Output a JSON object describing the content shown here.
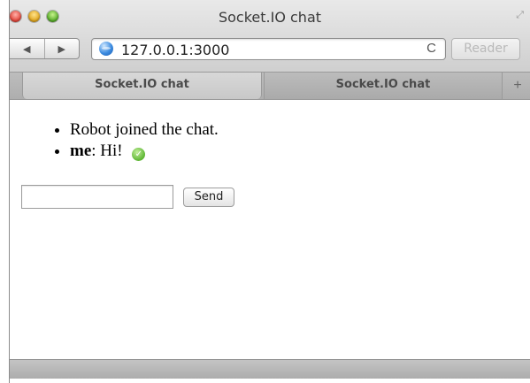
{
  "window": {
    "title": "Socket.IO chat"
  },
  "toolbar": {
    "back_icon": "◀",
    "forward_icon": "▶",
    "url": "127.0.0.1:3000",
    "reload_icon": "C",
    "reader_label": "Reader"
  },
  "tabs": [
    {
      "label": "Socket.IO chat",
      "active": true
    },
    {
      "label": "Socket.IO chat",
      "active": false
    }
  ],
  "new_tab_icon": "+",
  "messages": {
    "system": "Robot joined the chat.",
    "sender": "me",
    "separator": ":",
    "text": "Hi!",
    "delivered_icon": "✓"
  },
  "form": {
    "input_value": "",
    "send_label": "Send"
  },
  "colors": {
    "close": "#e3463b",
    "minimize": "#e0a61f",
    "zoom": "#58ae2a",
    "delivered": "#5cb532"
  }
}
